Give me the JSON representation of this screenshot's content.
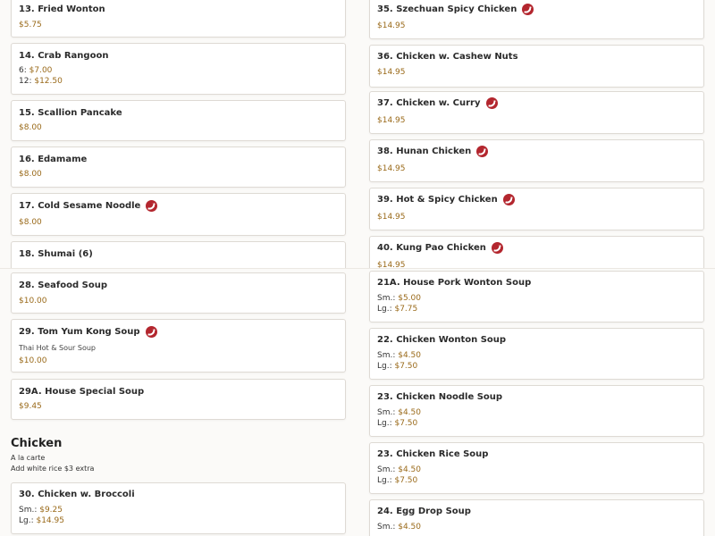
{
  "top": {
    "left": [
      {
        "name": "13. Fried Wonton",
        "spicy": false,
        "prices": [
          {
            "label": "",
            "price": "$5.75"
          }
        ]
      },
      {
        "name": "14. Crab Rangoon",
        "spicy": false,
        "prices": [
          {
            "label": "6: ",
            "price": "$7.00"
          },
          {
            "label": "12: ",
            "price": "$12.50"
          }
        ]
      },
      {
        "name": "15. Scallion Pancake",
        "spicy": false,
        "prices": [
          {
            "label": "",
            "price": "$8.00"
          }
        ]
      },
      {
        "name": "16. Edamame",
        "spicy": false,
        "prices": [
          {
            "label": "",
            "price": "$8.00"
          }
        ]
      },
      {
        "name": "17. Cold Sesame Noodle",
        "spicy": true,
        "prices": [
          {
            "label": "",
            "price": "$8.00"
          }
        ]
      },
      {
        "name": "18. Shumai (6)",
        "spicy": false,
        "prices": []
      }
    ],
    "right": [
      {
        "name": "35. Szechuan Spicy Chicken",
        "spicy": true,
        "prices": [
          {
            "label": "",
            "price": "$14.95"
          }
        ]
      },
      {
        "name": "36. Chicken w. Cashew Nuts",
        "spicy": false,
        "prices": [
          {
            "label": "",
            "price": "$14.95"
          }
        ]
      },
      {
        "name": "37. Chicken w. Curry",
        "spicy": true,
        "prices": [
          {
            "label": "",
            "price": "$14.95"
          }
        ]
      },
      {
        "name": "38. Hunan Chicken",
        "spicy": true,
        "prices": [
          {
            "label": "",
            "price": "$14.95"
          }
        ]
      },
      {
        "name": "39. Hot & Spicy Chicken",
        "spicy": true,
        "prices": [
          {
            "label": "",
            "price": "$14.95"
          }
        ]
      },
      {
        "name": "40. Kung Pao Chicken",
        "spicy": true,
        "prices": [
          {
            "label": "",
            "price": "$14.95"
          }
        ]
      }
    ]
  },
  "bottom": {
    "left": [
      {
        "name": "28. Seafood Soup",
        "spicy": false,
        "prices": [
          {
            "label": "",
            "price": "$10.00"
          }
        ]
      },
      {
        "name": "29. Tom Yum Kong Soup",
        "spicy": true,
        "desc": "Thai Hot & Sour Soup",
        "prices": [
          {
            "label": "",
            "price": "$10.00"
          }
        ]
      },
      {
        "name": "29A. House Special Soup",
        "spicy": false,
        "prices": [
          {
            "label": "",
            "price": "$9.45"
          }
        ]
      }
    ],
    "section": {
      "title": "Chicken",
      "note1": "A la carte",
      "note2": "Add white rice $3 extra"
    },
    "left_after": [
      {
        "name": "30. Chicken w. Broccoli",
        "spicy": false,
        "prices": [
          {
            "label": "Sm.: ",
            "price": "$9.25"
          },
          {
            "label": "Lg.: ",
            "price": "$14.95"
          }
        ]
      }
    ],
    "right": [
      {
        "name": "21A. House Pork Wonton Soup",
        "spicy": false,
        "prices": [
          {
            "label": "Sm.: ",
            "price": "$5.00"
          },
          {
            "label": "Lg.: ",
            "price": "$7.75"
          }
        ]
      },
      {
        "name": "22. Chicken Wonton Soup",
        "spicy": false,
        "prices": [
          {
            "label": "Sm.: ",
            "price": "$4.50"
          },
          {
            "label": "Lg.: ",
            "price": "$7.50"
          }
        ]
      },
      {
        "name": "23. Chicken Noodle Soup",
        "spicy": false,
        "prices": [
          {
            "label": "Sm.: ",
            "price": "$4.50"
          },
          {
            "label": "Lg.: ",
            "price": "$7.50"
          }
        ]
      },
      {
        "name": "23. Chicken Rice Soup",
        "spicy": false,
        "prices": [
          {
            "label": "Sm.: ",
            "price": "$4.50"
          },
          {
            "label": "Lg.: ",
            "price": "$7.50"
          }
        ]
      },
      {
        "name": "24. Egg Drop Soup",
        "spicy": false,
        "prices": [
          {
            "label": "Sm.: ",
            "price": "$4.50"
          }
        ]
      }
    ]
  }
}
